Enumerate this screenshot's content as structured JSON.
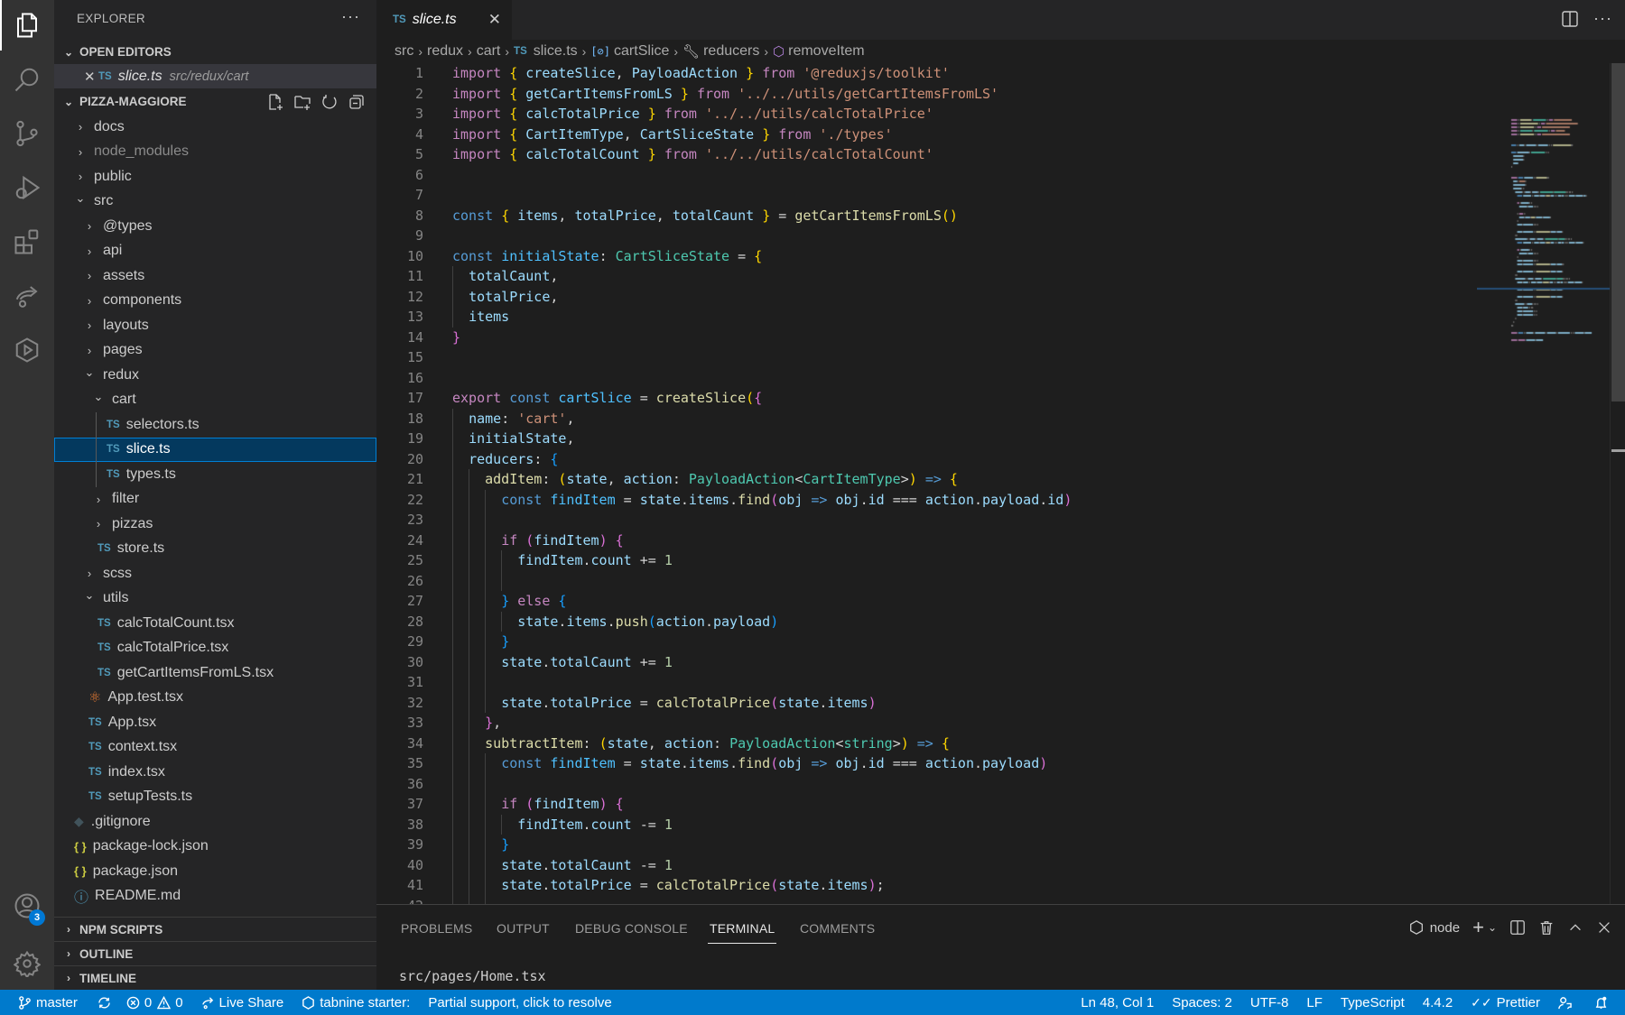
{
  "activity_bar": {
    "items": [
      {
        "name": "explorer",
        "icon": "files-icon",
        "active": true
      },
      {
        "name": "search",
        "icon": "search-icon"
      },
      {
        "name": "source-control",
        "icon": "source-control-icon"
      },
      {
        "name": "run-debug",
        "icon": "run-debug-icon"
      },
      {
        "name": "extensions",
        "icon": "extensions-icon"
      },
      {
        "name": "live-share",
        "icon": "live-share-icon"
      },
      {
        "name": "remote",
        "icon": "remote-explorer-icon"
      }
    ],
    "accounts_badge": "3"
  },
  "sidebar": {
    "title": "EXPLORER",
    "more": "···",
    "open_editors": {
      "header": "OPEN EDITORS",
      "items": [
        {
          "icon": "TS",
          "name": "slice.ts",
          "path": "src/redux/cart"
        }
      ]
    },
    "project": {
      "header": "PIZZA-MAGGIORE",
      "tree": [
        {
          "label": "docs",
          "type": "folder",
          "depth": 0,
          "expanded": false
        },
        {
          "label": "node_modules",
          "type": "folder",
          "depth": 0,
          "expanded": false,
          "dim": true
        },
        {
          "label": "public",
          "type": "folder",
          "depth": 0,
          "expanded": false
        },
        {
          "label": "src",
          "type": "folder",
          "depth": 0,
          "expanded": true
        },
        {
          "label": "@types",
          "type": "folder",
          "depth": 1,
          "expanded": false
        },
        {
          "label": "api",
          "type": "folder",
          "depth": 1,
          "expanded": false
        },
        {
          "label": "assets",
          "type": "folder",
          "depth": 1,
          "expanded": false
        },
        {
          "label": "components",
          "type": "folder",
          "depth": 1,
          "expanded": false
        },
        {
          "label": "layouts",
          "type": "folder",
          "depth": 1,
          "expanded": false
        },
        {
          "label": "pages",
          "type": "folder",
          "depth": 1,
          "expanded": false
        },
        {
          "label": "redux",
          "type": "folder",
          "depth": 1,
          "expanded": true
        },
        {
          "label": "cart",
          "type": "folder",
          "depth": 2,
          "expanded": true
        },
        {
          "label": "selectors.ts",
          "type": "ts",
          "depth": 3
        },
        {
          "label": "slice.ts",
          "type": "ts",
          "depth": 3,
          "selected": true
        },
        {
          "label": "types.ts",
          "type": "ts",
          "depth": 3
        },
        {
          "label": "filter",
          "type": "folder",
          "depth": 2,
          "expanded": false
        },
        {
          "label": "pizzas",
          "type": "folder",
          "depth": 2,
          "expanded": false
        },
        {
          "label": "store.ts",
          "type": "ts",
          "depth": 2
        },
        {
          "label": "scss",
          "type": "folder",
          "depth": 1,
          "expanded": false
        },
        {
          "label": "utils",
          "type": "folder",
          "depth": 1,
          "expanded": true
        },
        {
          "label": "calcTotalCount.tsx",
          "type": "ts",
          "depth": 2
        },
        {
          "label": "calcTotalPrice.tsx",
          "type": "ts",
          "depth": 2
        },
        {
          "label": "getCartItemsFromLS.tsx",
          "type": "ts",
          "depth": 2
        },
        {
          "label": "App.test.tsx",
          "type": "react",
          "depth": 1
        },
        {
          "label": "App.tsx",
          "type": "ts",
          "depth": 1
        },
        {
          "label": "context.tsx",
          "type": "ts",
          "depth": 1
        },
        {
          "label": "index.tsx",
          "type": "ts",
          "depth": 1
        },
        {
          "label": "setupTests.ts",
          "type": "ts",
          "depth": 1
        },
        {
          "label": ".gitignore",
          "type": "git",
          "depth": 0
        },
        {
          "label": "package-lock.json",
          "type": "json",
          "depth": 0
        },
        {
          "label": "package.json",
          "type": "json",
          "depth": 0
        },
        {
          "label": "README.md",
          "type": "info",
          "depth": 0
        }
      ]
    },
    "collapsed_sections": [
      "NPM SCRIPTS",
      "OUTLINE",
      "TIMELINE"
    ]
  },
  "editor": {
    "tab": {
      "icon": "TS",
      "name": "slice.ts"
    },
    "breadcrumb": [
      {
        "label": "src"
      },
      {
        "label": "redux"
      },
      {
        "label": "cart"
      },
      {
        "label": "slice.ts",
        "icon": "TS"
      },
      {
        "label": "cartSlice",
        "icon": "variable-icon"
      },
      {
        "label": "reducers",
        "icon": "wrench-icon"
      },
      {
        "label": "removeItem",
        "icon": "cube-icon"
      }
    ],
    "lines": [
      "import { createSlice, PayloadAction } from '@reduxjs/toolkit'",
      "import { getCartItemsFromLS } from '../../utils/getCartItemsFromLS'",
      "import { calcTotalPrice } from '../../utils/calcTotalPrice'",
      "import { CartItemType, CartSliceState } from './types'",
      "import { calcTotalCount } from '../../utils/calcTotalCount'",
      "",
      "",
      "const { items, totalPrice, totalCaunt } = getCartItemsFromLS()",
      "",
      "const initialState: CartSliceState = {",
      "  totalCaunt,",
      "  totalPrice,",
      "  items",
      "}",
      "",
      "",
      "export const cartSlice = createSlice({",
      "  name: 'cart',",
      "  initialState,",
      "  reducers: {",
      "    addItem: (state, action: PayloadAction<CartItemType>) => {",
      "      const findItem = state.items.find(obj => obj.id === action.payload.id)",
      "",
      "      if (findItem) {",
      "        findItem.count += 1",
      "",
      "      } else {",
      "        state.items.push(action.payload)",
      "      }",
      "      state.totalCaunt += 1",
      "",
      "      state.totalPrice = calcTotalPrice(state.items)",
      "    },",
      "    subtractItem: (state, action: PayloadAction<string>) => {",
      "      const findItem = state.items.find(obj => obj.id === action.payload)",
      "",
      "      if (findItem) {",
      "        findItem.count -= 1",
      "      }",
      "      state.totalCaunt -= 1",
      "      state.totalPrice = calcTotalPrice(state.items);",
      ""
    ],
    "first_line_number": 1
  },
  "panel": {
    "tabs": [
      "PROBLEMS",
      "OUTPUT",
      "DEBUG CONSOLE",
      "TERMINAL",
      "COMMENTS"
    ],
    "active_tab": "TERMINAL",
    "terminal_name": "node",
    "terminal_output": "src/pages/Home.tsx"
  },
  "status_bar": {
    "branch": "master",
    "errors": "0",
    "warnings": "0",
    "live_share": "Live Share",
    "tabnine": "tabnine starter:",
    "tabnine_message": "Partial support, click to resolve",
    "position": "Ln 48, Col 1",
    "spaces": "Spaces: 2",
    "encoding": "UTF-8",
    "eol": "LF",
    "language": "TypeScript",
    "ts_version": "4.4.2",
    "formatter": "Prettier",
    "colors": {
      "background": "#007acc",
      "foreground": "#ffffff"
    }
  }
}
